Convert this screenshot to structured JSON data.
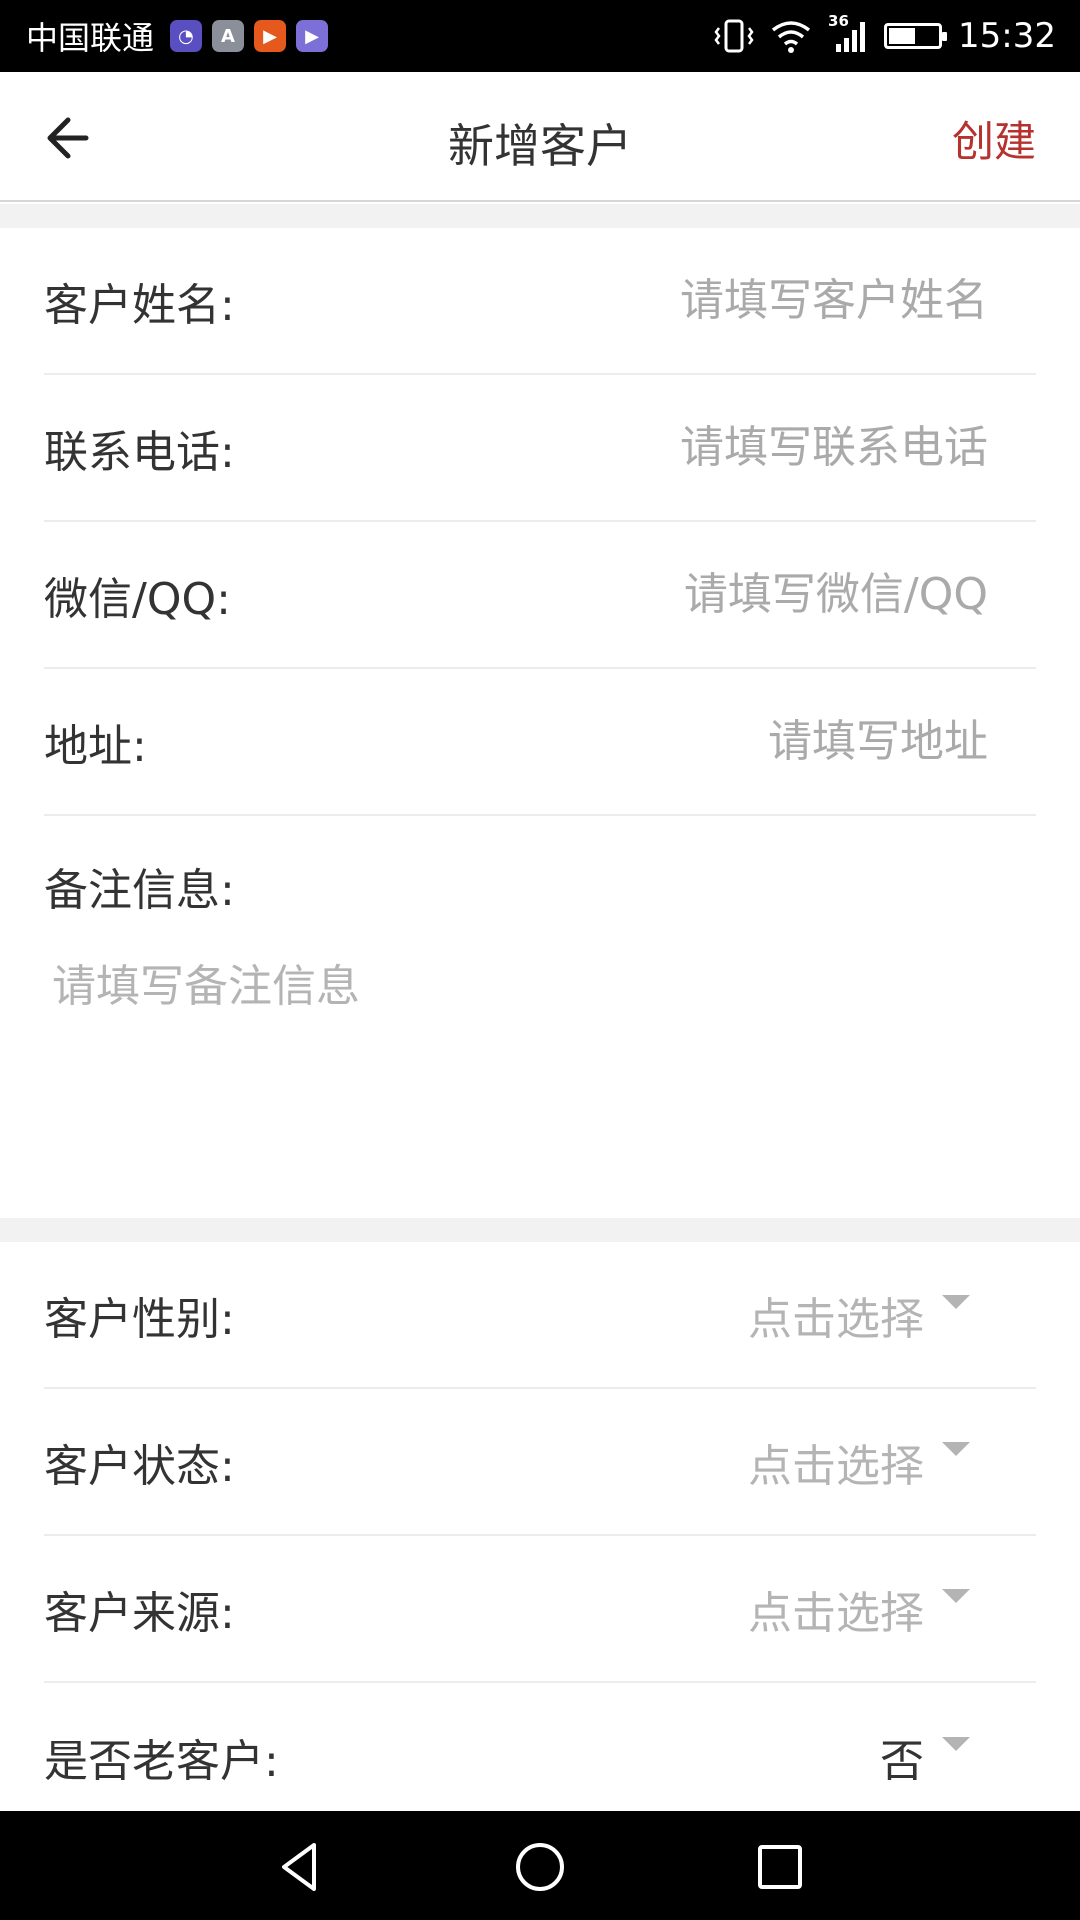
{
  "status_bar": {
    "carrier": "中国联通",
    "app_icons": [
      {
        "name": "clock-app-icon",
        "glyph": "◔",
        "color": "#5a4fc0"
      },
      {
        "name": "a-app-icon",
        "glyph": "A",
        "color": "#8a8f99"
      },
      {
        "name": "video-app-icon",
        "glyph": "▶",
        "color": "#e55a1c"
      },
      {
        "name": "media-app-icon",
        "glyph": "▶",
        "color": "#7c6fd8"
      }
    ],
    "network": "36",
    "time": "15:32"
  },
  "app_bar": {
    "title": "新增客户",
    "action": "创建",
    "action_color": "#b5322e"
  },
  "form": {
    "fields": [
      {
        "label": "客户姓名:",
        "placeholder": "请填写客户姓名"
      },
      {
        "label": "联系电话:",
        "placeholder": "请填写联系电话"
      },
      {
        "label": "微信/QQ:",
        "placeholder": "请填写微信/QQ"
      },
      {
        "label": "地址:",
        "placeholder": "请填写地址"
      }
    ],
    "notes": {
      "label": "备注信息:",
      "placeholder": "请填写备注信息"
    },
    "selects": [
      {
        "label": "客户性别:",
        "value": "点击选择"
      },
      {
        "label": "客户状态:",
        "value": "点击选择"
      },
      {
        "label": "客户来源:",
        "value": "点击选择"
      },
      {
        "label": "是否老客户:",
        "value": "否"
      }
    ]
  }
}
